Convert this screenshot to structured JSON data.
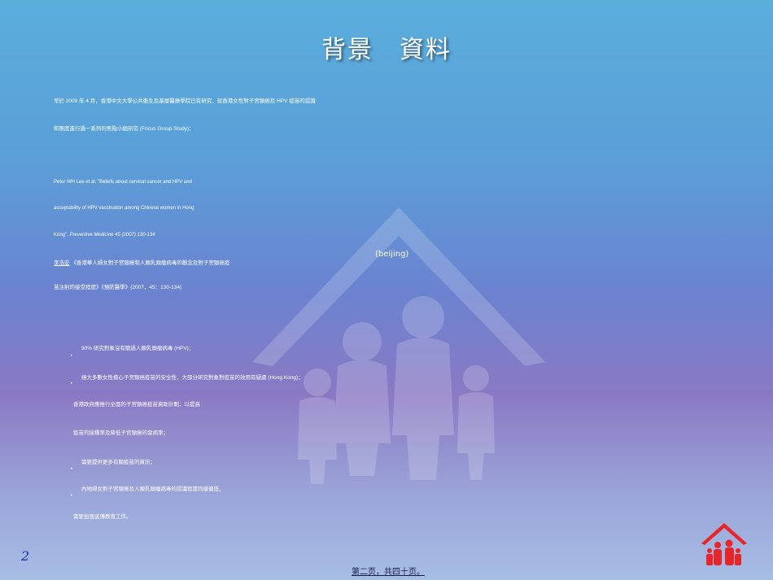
{
  "slide": {
    "title": "背景　資料",
    "paragraph1": {
      "line1": "早於 2009 年 4 月，香港中文大學公共衞生及基層醫療學院已有研究，就香港女性對子宮頸癌及 HPV 疫苗的認識",
      "line2": "和態度進行過一系列的焦點小組研究",
      "line2_en": "(Focus Group Study)："
    },
    "citation": {
      "line1": "Peter WH Lee et al. \"Beliefs about cervical cancer and HPV and",
      "line2": "acceptability of HPV vaccination among Chinese women in Hong",
      "line3": "Kong\".",
      "journal": "Preventive Medicine 45 (2007) 130-134",
      "link": "李浩宏",
      "line4": "《香港華人婦女對子宮頸癌和人類乳頭瘤病毒的觀念及對子宮頸癌疫",
      "line5": "苗注射的接受程度》《預防醫學》(2007，45：130-134)"
    },
    "center_note": "(beijing)",
    "findings": {
      "item1": "90% 研究對象沒有聽過人類乳頭瘤病毒 (HPV)；",
      "item2a": "絕大多數女性擔心子宮頸癌疫苗的安全性，大部分研究對象對疫苗的效用有疑慮 (Hong Kong)；",
      "item2b": "香港政府應推行全面的子宮頸癌疫苗資助計劃，以提高",
      "item2c": "疫苗的接種率及降低子宮頸癌的發病率；",
      "item3a": "需要提供更多有關疫苗的資訊；",
      "item3b": "內地婦女對子宮頸癌及人類乳頭瘤病毒的認識程度同樣偏低，",
      "item3c": "需要加強宣傳教育工作。"
    },
    "page_number": "2",
    "footer": "第二页，共四十页。"
  },
  "colors": {
    "title": "#ffffff",
    "page_number": "#1a2eb8",
    "logo": "#e8262a"
  },
  "icons": {
    "watermark": "family-house-icon",
    "logo": "family-house-logo-icon"
  }
}
